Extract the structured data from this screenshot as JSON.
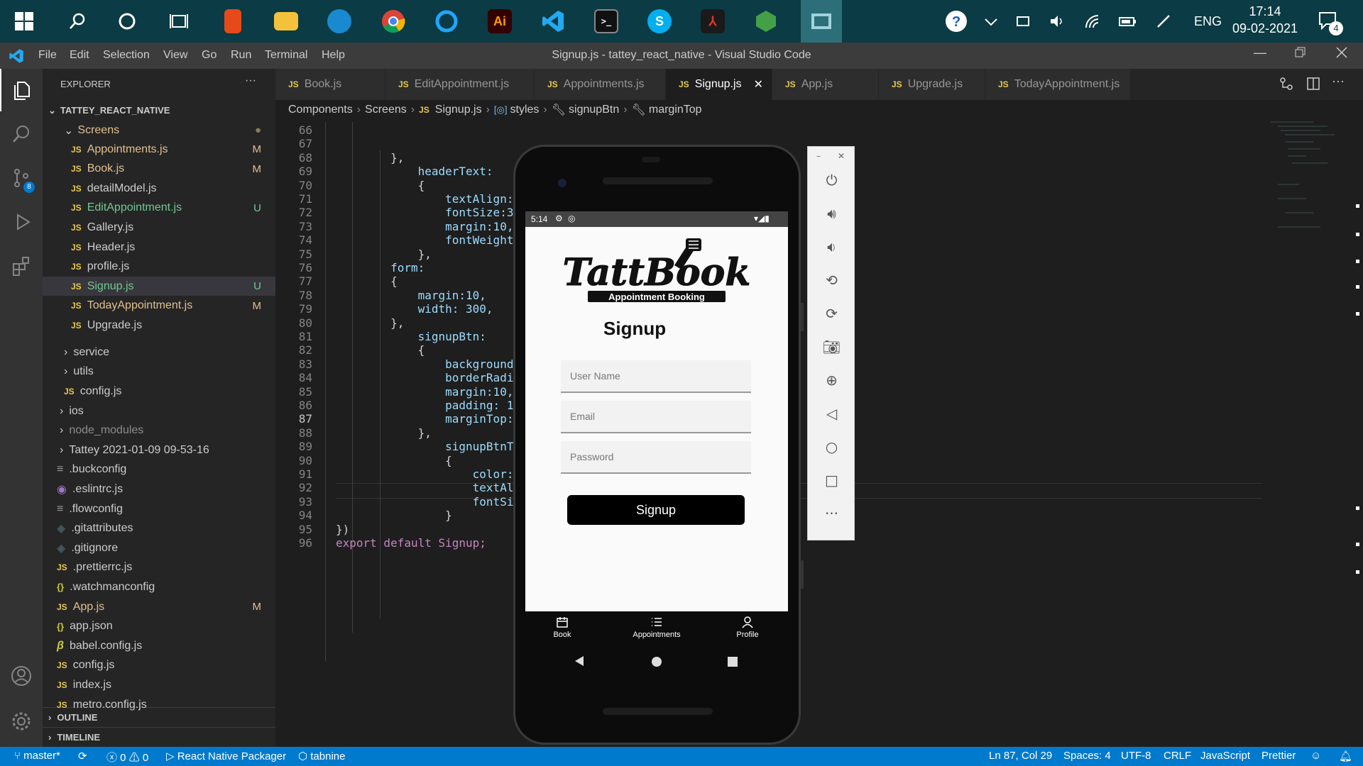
{
  "taskbar": {
    "tray_lang": "ENG",
    "clock_time": "17:14",
    "clock_date": "09-02-2021",
    "notification_count": "4",
    "apps": [
      "start",
      "search",
      "cortana",
      "task-view",
      "office",
      "file-explorer",
      "edge",
      "chrome",
      "cortana-ring",
      "illustrator",
      "vscode",
      "terminal",
      "skype",
      "acrobat",
      "nodejs",
      "emulator"
    ]
  },
  "window": {
    "title": "Signup.js - tattey_react_native - Visual Studio Code",
    "menu": [
      "File",
      "Edit",
      "Selection",
      "View",
      "Go",
      "Run",
      "Terminal",
      "Help"
    ]
  },
  "activity": {
    "scm_badge": "8"
  },
  "explorer": {
    "header": "EXPLORER",
    "more": "···",
    "project": "TATTEY_REACT_NATIVE",
    "folder_screens": "Screens",
    "files": [
      {
        "name": "Appointments.js",
        "status": "M",
        "color": "#e2c08d"
      },
      {
        "name": "Book.js",
        "status": "M",
        "color": "#e2c08d"
      },
      {
        "name": "detailModel.js",
        "status": "",
        "color": "#cccccc"
      },
      {
        "name": "EditAppointment.js",
        "status": "U",
        "color": "#73c991"
      },
      {
        "name": "Gallery.js",
        "status": "",
        "color": "#cccccc"
      },
      {
        "name": "Header.js",
        "status": "",
        "color": "#cccccc"
      },
      {
        "name": "profile.js",
        "status": "",
        "color": "#cccccc"
      },
      {
        "name": "Signup.js",
        "status": "U",
        "color": "#73c991"
      },
      {
        "name": "TodayAppointment.js",
        "status": "M",
        "color": "#e2c08d"
      },
      {
        "name": "Upgrade.js",
        "status": "",
        "color": "#cccccc"
      }
    ],
    "folders_sub": [
      "service",
      "utils"
    ],
    "config_sub": "config.js",
    "root_items": [
      {
        "name": "ios",
        "type": "folder"
      },
      {
        "name": "node_modules",
        "type": "folder"
      },
      {
        "name": "Tattey 2021-01-09 09-53-16",
        "type": "folder"
      },
      {
        "name": ".buckconfig",
        "type": "lines"
      },
      {
        "name": ".eslintrc.js",
        "type": "eslint"
      },
      {
        "name": ".flowconfig",
        "type": "lines"
      },
      {
        "name": ".gitattributes",
        "type": "git"
      },
      {
        "name": ".gitignore",
        "type": "git"
      },
      {
        "name": ".prettierrc.js",
        "type": "js"
      },
      {
        "name": ".watchmanconfig",
        "type": "json"
      },
      {
        "name": "App.js",
        "type": "js",
        "status": "M"
      },
      {
        "name": "app.json",
        "type": "json"
      },
      {
        "name": "babel.config.js",
        "type": "babel"
      },
      {
        "name": "config.js",
        "type": "js"
      },
      {
        "name": "index.js",
        "type": "js"
      },
      {
        "name": "metro.config.js",
        "type": "js"
      }
    ],
    "outline": "OUTLINE",
    "timeline": "TIMELINE"
  },
  "tabs": [
    "Book.js",
    "EditAppointment.js",
    "Appointments.js",
    "Signup.js",
    "App.js",
    "Upgrade.js",
    "TodayAppointment.js"
  ],
  "active_tab": "Signup.js",
  "breadcrumb": [
    "Components",
    "Screens",
    "Signup.js",
    "styles",
    "signupBtn",
    "marginTop"
  ],
  "code_lines": [
    {
      "n": "66",
      "t": ""
    },
    {
      "n": "67",
      "t": ""
    },
    {
      "n": "68",
      "t": "        },"
    },
    {
      "n": "69",
      "t": "            headerText:"
    },
    {
      "n": "70",
      "t": "            {"
    },
    {
      "n": "71",
      "t": "                textAlign:"
    },
    {
      "n": "72",
      "t": "                fontSize:3"
    },
    {
      "n": "73",
      "t": "                margin:10,"
    },
    {
      "n": "74",
      "t": "                fontWeight"
    },
    {
      "n": "75",
      "t": "            },"
    },
    {
      "n": "76",
      "t": "        form:"
    },
    {
      "n": "77",
      "t": "        {"
    },
    {
      "n": "78",
      "t": "            margin:10,"
    },
    {
      "n": "79",
      "t": "            width: 300,"
    },
    {
      "n": "80",
      "t": "        },"
    },
    {
      "n": "81",
      "t": "            signupBtn:"
    },
    {
      "n": "82",
      "t": "            {"
    },
    {
      "n": "83",
      "t": "                background"
    },
    {
      "n": "84",
      "t": "                borderRadi"
    },
    {
      "n": "85",
      "t": "                margin:10,"
    },
    {
      "n": "86",
      "t": "                padding: 1"
    },
    {
      "n": "87",
      "t": "                marginTop:"
    },
    {
      "n": "88",
      "t": "            },"
    },
    {
      "n": "89",
      "t": "                signupBtnT"
    },
    {
      "n": "90",
      "t": "                {"
    },
    {
      "n": "91",
      "t": "                    color:"
    },
    {
      "n": "92",
      "t": "                    textAl"
    },
    {
      "n": "93",
      "t": "                    fontSi"
    },
    {
      "n": "94",
      "t": "                }"
    },
    {
      "n": "95",
      "t": "})"
    },
    {
      "n": "96",
      "t": "export default Signup;"
    }
  ],
  "phone": {
    "status_time": "5:14",
    "logo_text": "TattBook",
    "logo_sub": "Appointment Booking",
    "title": "Signup",
    "username_placeholder": "User Name",
    "email_placeholder": "Email",
    "password_placeholder": "Password",
    "button": "Signup",
    "nav": [
      "Book",
      "Appointments",
      "Profile"
    ]
  },
  "status": {
    "branch": "master*",
    "errors": "0",
    "warnings": "0",
    "packager": "React Native Packager",
    "tabnine": "tabnine",
    "position": "Ln 87, Col 29",
    "spaces": "Spaces: 4",
    "encoding": "UTF-8",
    "eol": "CRLF",
    "language": "JavaScript",
    "prettier": "Prettier"
  },
  "colors": {
    "accent": "#007acc",
    "taskbar": "#0b3b44"
  }
}
